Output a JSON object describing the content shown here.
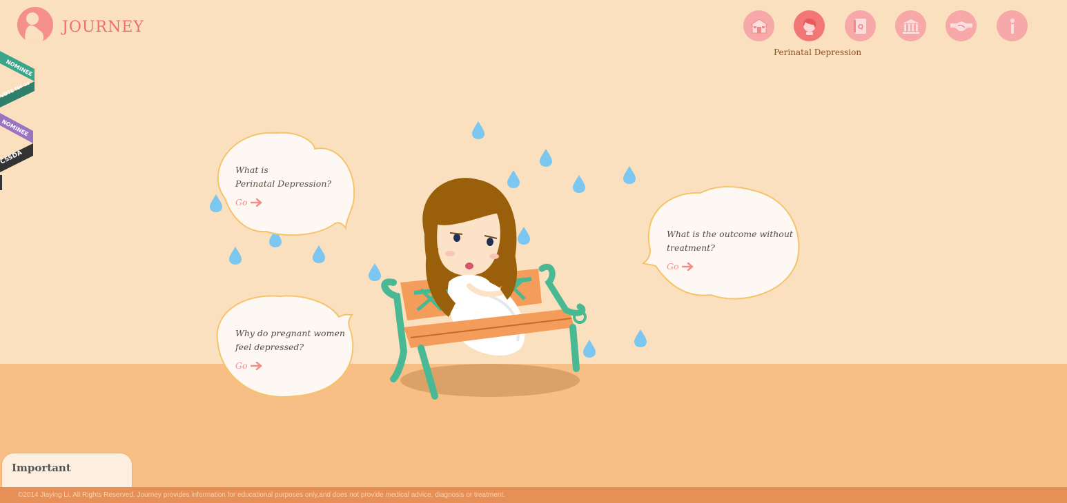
{
  "app": {
    "logo_text": "JOURNEY"
  },
  "nav": {
    "items": [
      {
        "icon": "home-icon",
        "label": "Home"
      },
      {
        "icon": "woman-face-icon",
        "label": "Perinatal Depression",
        "active": true
      },
      {
        "icon": "question-book-icon",
        "label": "Q&A"
      },
      {
        "icon": "institution-icon",
        "label": "Resources"
      },
      {
        "icon": "handshake-icon",
        "label": "Support"
      },
      {
        "icon": "info-icon",
        "label": "About"
      }
    ],
    "active_label": "Perinatal Depression"
  },
  "ribbons": {
    "items": [
      "NOMINEE",
      "VOTE for us",
      "NOMINEE",
      "CSSDA"
    ]
  },
  "bubbles": {
    "what_is": {
      "line1": "What is",
      "line2": "Perinatal Depression?",
      "go": "Go"
    },
    "why": {
      "line1": "Why do pregnant women",
      "line2": "feel depressed?",
      "go": "Go"
    },
    "outcome": {
      "line1": "What is the outcome without",
      "line2": "treatment?",
      "go": "Go"
    }
  },
  "important": {
    "label": "Important"
  },
  "footer": {
    "text": "©2014 Jiaying Li, All Rights Reserved. Journey provides information for educational purposes only,and does not provide medical advice, diagnosis or treatment."
  },
  "colors": {
    "background": "#fbe0bf",
    "ground": "#f7bf85",
    "footer": "#e69058",
    "accent": "#f37677",
    "drop": "#7cc7ef"
  }
}
